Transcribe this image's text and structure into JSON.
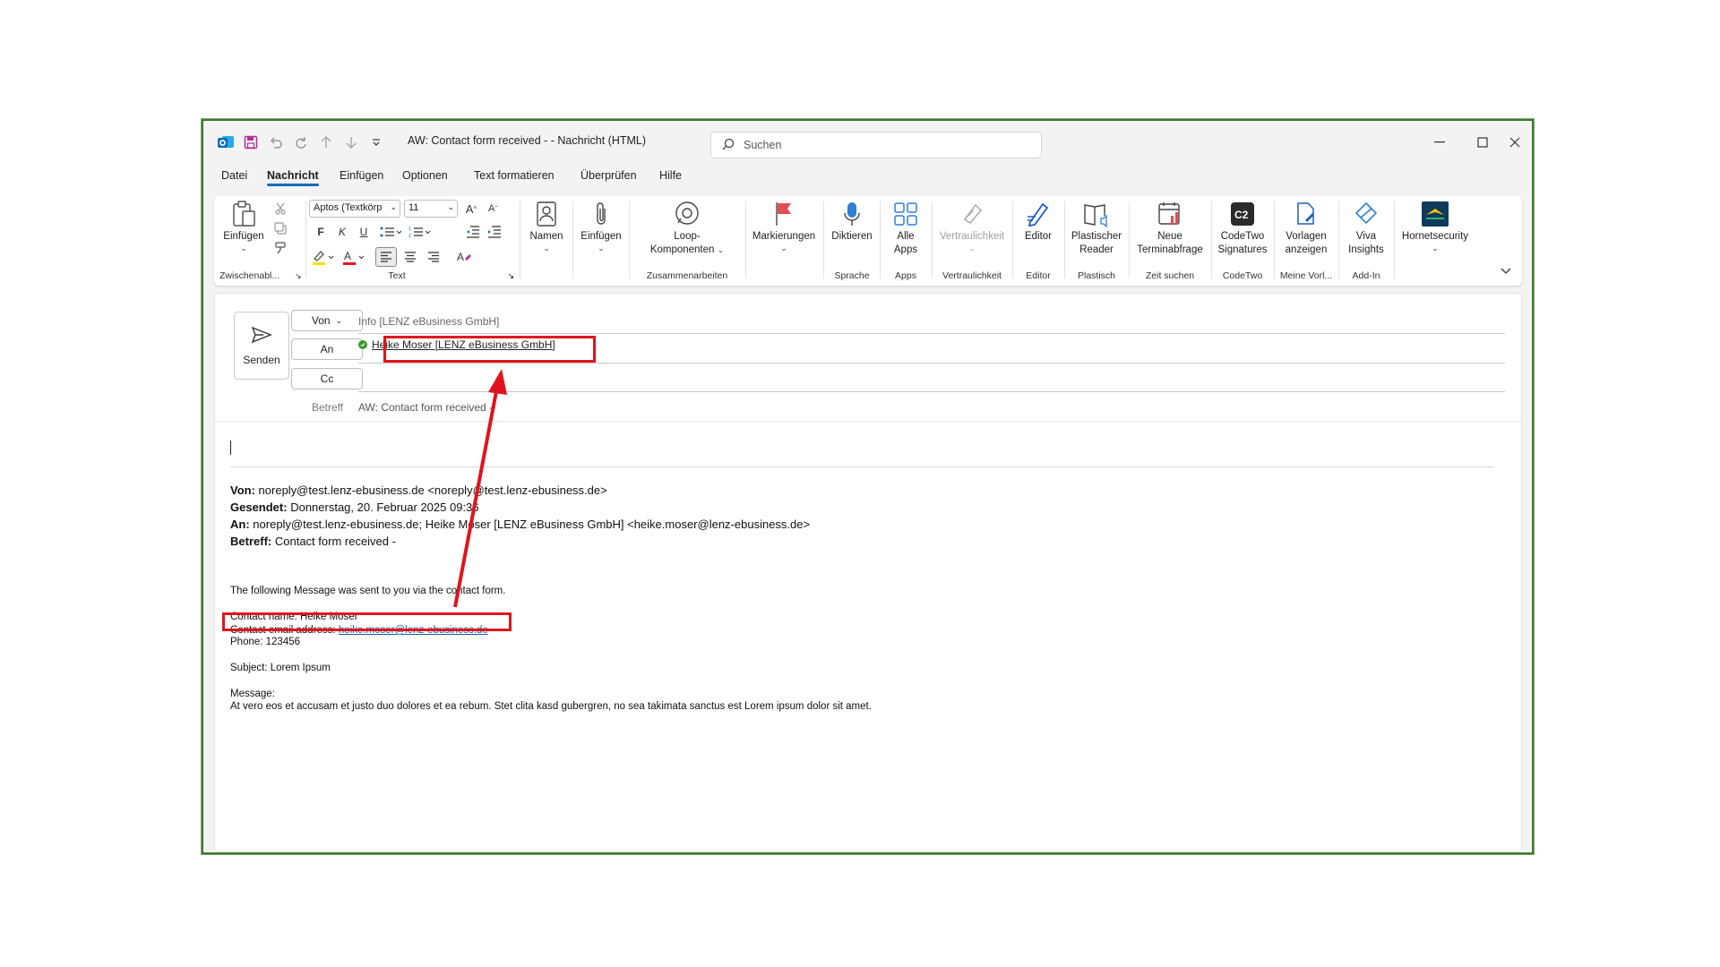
{
  "window": {
    "title": "AW: Contact form received -  - Nachricht (HTML)",
    "search_placeholder": "Suchen"
  },
  "menu": {
    "tabs": [
      "Datei",
      "Nachricht",
      "Einfügen",
      "Optionen",
      "Text formatieren",
      "Überprüfen",
      "Hilfe"
    ],
    "active": "Nachricht"
  },
  "ribbon": {
    "clipboard": {
      "paste": "Einfügen",
      "group": "Zwischenabl..."
    },
    "text": {
      "font": "Aptos (Textkörp",
      "size": "11",
      "bold": "F",
      "italic": "K",
      "underline": "U",
      "group": "Text"
    },
    "names": "Namen",
    "attach": "Einfügen",
    "loop_line1": "Loop-",
    "loop_line2": "Komponenten",
    "loop_group": "Zusammenarbeiten",
    "flags": "Markierungen",
    "dictate": "Diktieren",
    "dictate_group": "Sprache",
    "apps_line1": "Alle",
    "apps_line2": "Apps",
    "apps_group": "Apps",
    "sensitivity": "Vertraulichkeit",
    "sensitivity_group": "Vertraulichkeit",
    "editor": "Editor",
    "editor_group": "Editor",
    "reader_line1": "Plastischer",
    "reader_line2": "Reader",
    "reader_group": "Plastisch",
    "meeting_line1": "Neue",
    "meeting_line2": "Terminabfrage",
    "meeting_group": "Zeit suchen",
    "codetwo_line1": "CodeTwo",
    "codetwo_line2": "Signatures",
    "codetwo_group": "CodeTwo",
    "templates_line1": "Vorlagen",
    "templates_line2": "anzeigen",
    "templates_group": "Meine Vorl...",
    "viva_line1": "Viva",
    "viva_line2": "Insights",
    "viva_group": "Add-In",
    "hornet": "Hornetsecurity"
  },
  "compose": {
    "send": "Senden",
    "from_btn": "Von",
    "from_value": "Info [LENZ eBusiness GmbH]",
    "to_btn": "An",
    "to_value": "Heike Moser [LENZ eBusiness GmbH]",
    "cc_btn": "Cc",
    "subject_label": "Betreff",
    "subject_value": "AW: Contact form received -"
  },
  "quoted": {
    "from_label": "Von:",
    "from_value": "noreply@test.lenz-ebusiness.de <noreply@test.lenz-ebusiness.de>",
    "sent_label": "Gesendet:",
    "sent_value": "Donnerstag, 20. Februar 2025 09:36",
    "to_label": "An:",
    "to_value": "noreply@test.lenz-ebusiness.de; Heike Moser [LENZ eBusiness GmbH] <heike.moser@lenz-ebusiness.de>",
    "subject_label": "Betreff:",
    "subject_value": "Contact form received -"
  },
  "message": {
    "intro": "The following Message was sent to you via the contact form.",
    "name_line": "Contact name: Heike Moser",
    "email_label": "Contact email address:",
    "email_value": "heike.moser@lenz-ebusiness.de",
    "phone_line": "Phone: 123456",
    "subject_line": "Subject: Lorem Ipsum",
    "message_label": "Message:",
    "message_body": "At vero eos et accusam et justo duo dolores et ea rebum. Stet clita kasd gubergren, no sea takimata sanctus est Lorem ipsum dolor sit amet."
  },
  "colors": {
    "accent": "#0f6cbd",
    "annotation": "#e0141e",
    "window_border": "#3d7a32"
  }
}
